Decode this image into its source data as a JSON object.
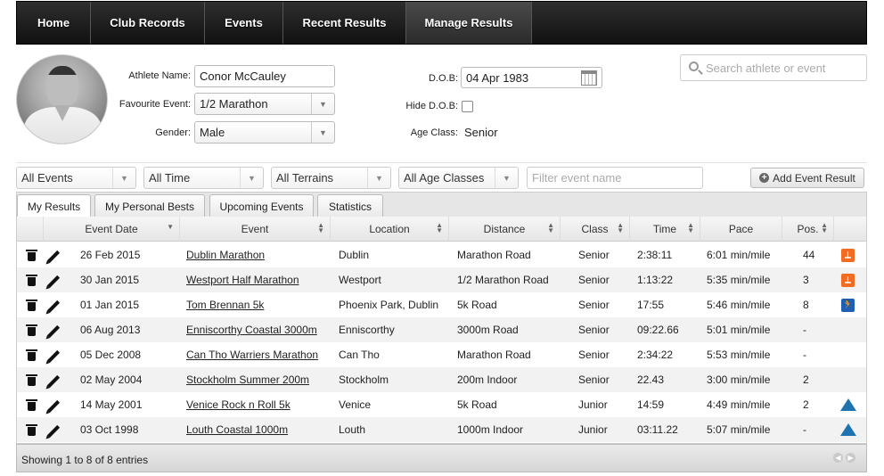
{
  "nav": [
    {
      "label": "Home",
      "active": false
    },
    {
      "label": "Club Records",
      "active": false
    },
    {
      "label": "Events",
      "active": false
    },
    {
      "label": "Recent Results",
      "active": false
    },
    {
      "label": "Manage Results",
      "active": true
    }
  ],
  "profile": {
    "athlete_name_label": "Athlete Name:",
    "athlete_name": "Conor McCauley",
    "fav_event_label": "Favourite Event:",
    "fav_event": "1/2 Marathon",
    "gender_label": "Gender:",
    "gender": "Male",
    "dob_label": "D.O.B:",
    "dob": "04 Apr 1983",
    "hide_dob_label": "Hide D.O.B:",
    "hide_dob_checked": false,
    "age_class_label": "Age Class:",
    "age_class": "Senior"
  },
  "search": {
    "placeholder": "Search athlete or event"
  },
  "filters": {
    "events": "All Events",
    "time": "All Time",
    "terrains": "All Terrains",
    "age_classes": "All Age Classes",
    "event_name_placeholder": "Filter event name",
    "add_button": "Add Event Result"
  },
  "tabs": [
    {
      "label": "My Results",
      "active": true
    },
    {
      "label": "My Personal Bests",
      "active": false
    },
    {
      "label": "Upcoming Events",
      "active": false
    },
    {
      "label": "Statistics",
      "active": false
    }
  ],
  "table": {
    "columns": [
      "Event Date",
      "Event",
      "Location",
      "Distance",
      "Class",
      "Time",
      "Pace",
      "Pos."
    ],
    "rows": [
      {
        "date": "26 Feb 2015",
        "event": "Dublin Marathon",
        "location": "Dublin",
        "distance": "Marathon Road",
        "class": "Senior",
        "time": "2:38:11",
        "pace": "6:01 min/mile",
        "pos": "44",
        "icon": "road-run-icon"
      },
      {
        "date": "30 Jan 2015",
        "event": "Westport Half Marathon",
        "location": "Westport",
        "distance": "1/2 Marathon Road",
        "class": "Senior",
        "time": "1:13:22",
        "pace": "5:35 min/mile",
        "pos": "3",
        "icon": "road-run-icon"
      },
      {
        "date": "01 Jan 2015",
        "event": "Tom Brennan 5k",
        "location": "Phoenix Park, Dublin",
        "distance": "5k Road",
        "class": "Senior",
        "time": "17:55",
        "pace": "5:46 min/mile",
        "pos": "8",
        "icon": "runner-icon"
      },
      {
        "date": "06 Aug 2013",
        "event": "Enniscorthy Coastal 3000m",
        "location": "Enniscorthy",
        "distance": "3000m Road",
        "class": "Senior",
        "time": "09:22.66",
        "pace": "5:01 min/mile",
        "pos": "-",
        "icon": ""
      },
      {
        "date": "05 Dec 2008",
        "event": "Can Tho Warriers Marathon",
        "location": "Can Tho",
        "distance": "Marathon Road",
        "class": "Senior",
        "time": "2:34:22",
        "pace": "5:53 min/mile",
        "pos": "-",
        "icon": ""
      },
      {
        "date": "02 May 2004",
        "event": "Stockholm Summer 200m",
        "location": "Stockholm",
        "distance": "200m Indoor",
        "class": "Senior",
        "time": "22.43",
        "pace": "3:00 min/mile",
        "pos": "2",
        "icon": ""
      },
      {
        "date": "14 May 2001",
        "event": "Venice Rock n Roll 5k",
        "location": "Venice",
        "distance": "5k Road",
        "class": "Junior",
        "time": "14:59",
        "pace": "4:49 min/mile",
        "pos": "2",
        "icon": "triangle-icon"
      },
      {
        "date": "03 Oct 1998",
        "event": "Louth Coastal 1000m",
        "location": "Louth",
        "distance": "1000m Indoor",
        "class": "Junior",
        "time": "03:11.22",
        "pace": "5:07 min/mile",
        "pos": "-",
        "icon": "triangle-icon"
      }
    ]
  },
  "footer": {
    "info": "Showing 1 to 8 of 8 entries"
  },
  "colors": {
    "badge_orange": "#f36b21",
    "badge_blue": "#1e5fb3",
    "triangle_blue": "#1f73b0"
  }
}
